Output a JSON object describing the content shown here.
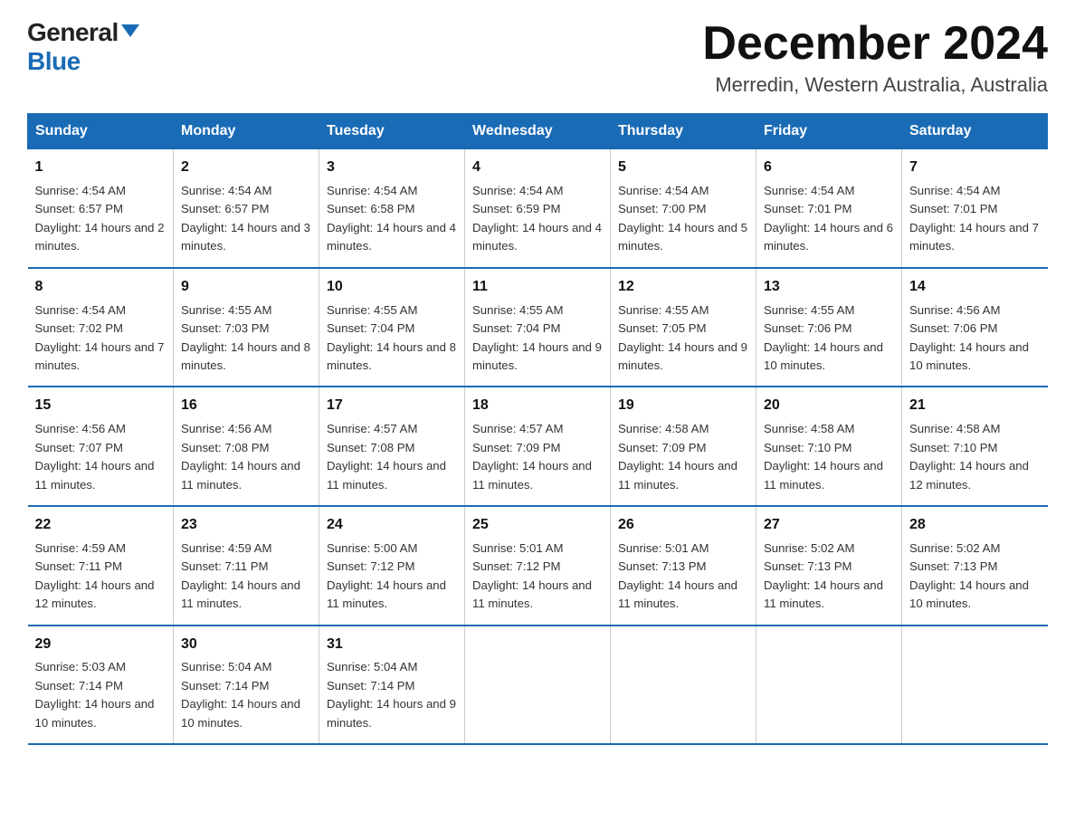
{
  "header": {
    "logo_general": "General",
    "logo_blue": "Blue",
    "month_title": "December 2024",
    "location": "Merredin, Western Australia, Australia"
  },
  "days_of_week": [
    "Sunday",
    "Monday",
    "Tuesday",
    "Wednesday",
    "Thursday",
    "Friday",
    "Saturday"
  ],
  "weeks": [
    [
      {
        "day": "1",
        "sunrise": "4:54 AM",
        "sunset": "6:57 PM",
        "daylight": "14 hours and 2 minutes."
      },
      {
        "day": "2",
        "sunrise": "4:54 AM",
        "sunset": "6:57 PM",
        "daylight": "14 hours and 3 minutes."
      },
      {
        "day": "3",
        "sunrise": "4:54 AM",
        "sunset": "6:58 PM",
        "daylight": "14 hours and 4 minutes."
      },
      {
        "day": "4",
        "sunrise": "4:54 AM",
        "sunset": "6:59 PM",
        "daylight": "14 hours and 4 minutes."
      },
      {
        "day": "5",
        "sunrise": "4:54 AM",
        "sunset": "7:00 PM",
        "daylight": "14 hours and 5 minutes."
      },
      {
        "day": "6",
        "sunrise": "4:54 AM",
        "sunset": "7:01 PM",
        "daylight": "14 hours and 6 minutes."
      },
      {
        "day": "7",
        "sunrise": "4:54 AM",
        "sunset": "7:01 PM",
        "daylight": "14 hours and 7 minutes."
      }
    ],
    [
      {
        "day": "8",
        "sunrise": "4:54 AM",
        "sunset": "7:02 PM",
        "daylight": "14 hours and 7 minutes."
      },
      {
        "day": "9",
        "sunrise": "4:55 AM",
        "sunset": "7:03 PM",
        "daylight": "14 hours and 8 minutes."
      },
      {
        "day": "10",
        "sunrise": "4:55 AM",
        "sunset": "7:04 PM",
        "daylight": "14 hours and 8 minutes."
      },
      {
        "day": "11",
        "sunrise": "4:55 AM",
        "sunset": "7:04 PM",
        "daylight": "14 hours and 9 minutes."
      },
      {
        "day": "12",
        "sunrise": "4:55 AM",
        "sunset": "7:05 PM",
        "daylight": "14 hours and 9 minutes."
      },
      {
        "day": "13",
        "sunrise": "4:55 AM",
        "sunset": "7:06 PM",
        "daylight": "14 hours and 10 minutes."
      },
      {
        "day": "14",
        "sunrise": "4:56 AM",
        "sunset": "7:06 PM",
        "daylight": "14 hours and 10 minutes."
      }
    ],
    [
      {
        "day": "15",
        "sunrise": "4:56 AM",
        "sunset": "7:07 PM",
        "daylight": "14 hours and 11 minutes."
      },
      {
        "day": "16",
        "sunrise": "4:56 AM",
        "sunset": "7:08 PM",
        "daylight": "14 hours and 11 minutes."
      },
      {
        "day": "17",
        "sunrise": "4:57 AM",
        "sunset": "7:08 PM",
        "daylight": "14 hours and 11 minutes."
      },
      {
        "day": "18",
        "sunrise": "4:57 AM",
        "sunset": "7:09 PM",
        "daylight": "14 hours and 11 minutes."
      },
      {
        "day": "19",
        "sunrise": "4:58 AM",
        "sunset": "7:09 PM",
        "daylight": "14 hours and 11 minutes."
      },
      {
        "day": "20",
        "sunrise": "4:58 AM",
        "sunset": "7:10 PM",
        "daylight": "14 hours and 11 minutes."
      },
      {
        "day": "21",
        "sunrise": "4:58 AM",
        "sunset": "7:10 PM",
        "daylight": "14 hours and 12 minutes."
      }
    ],
    [
      {
        "day": "22",
        "sunrise": "4:59 AM",
        "sunset": "7:11 PM",
        "daylight": "14 hours and 12 minutes."
      },
      {
        "day": "23",
        "sunrise": "4:59 AM",
        "sunset": "7:11 PM",
        "daylight": "14 hours and 11 minutes."
      },
      {
        "day": "24",
        "sunrise": "5:00 AM",
        "sunset": "7:12 PM",
        "daylight": "14 hours and 11 minutes."
      },
      {
        "day": "25",
        "sunrise": "5:01 AM",
        "sunset": "7:12 PM",
        "daylight": "14 hours and 11 minutes."
      },
      {
        "day": "26",
        "sunrise": "5:01 AM",
        "sunset": "7:13 PM",
        "daylight": "14 hours and 11 minutes."
      },
      {
        "day": "27",
        "sunrise": "5:02 AM",
        "sunset": "7:13 PM",
        "daylight": "14 hours and 11 minutes."
      },
      {
        "day": "28",
        "sunrise": "5:02 AM",
        "sunset": "7:13 PM",
        "daylight": "14 hours and 10 minutes."
      }
    ],
    [
      {
        "day": "29",
        "sunrise": "5:03 AM",
        "sunset": "7:14 PM",
        "daylight": "14 hours and 10 minutes."
      },
      {
        "day": "30",
        "sunrise": "5:04 AM",
        "sunset": "7:14 PM",
        "daylight": "14 hours and 10 minutes."
      },
      {
        "day": "31",
        "sunrise": "5:04 AM",
        "sunset": "7:14 PM",
        "daylight": "14 hours and 9 minutes."
      },
      {
        "day": "",
        "sunrise": "",
        "sunset": "",
        "daylight": ""
      },
      {
        "day": "",
        "sunrise": "",
        "sunset": "",
        "daylight": ""
      },
      {
        "day": "",
        "sunrise": "",
        "sunset": "",
        "daylight": ""
      },
      {
        "day": "",
        "sunrise": "",
        "sunset": "",
        "daylight": ""
      }
    ]
  ]
}
